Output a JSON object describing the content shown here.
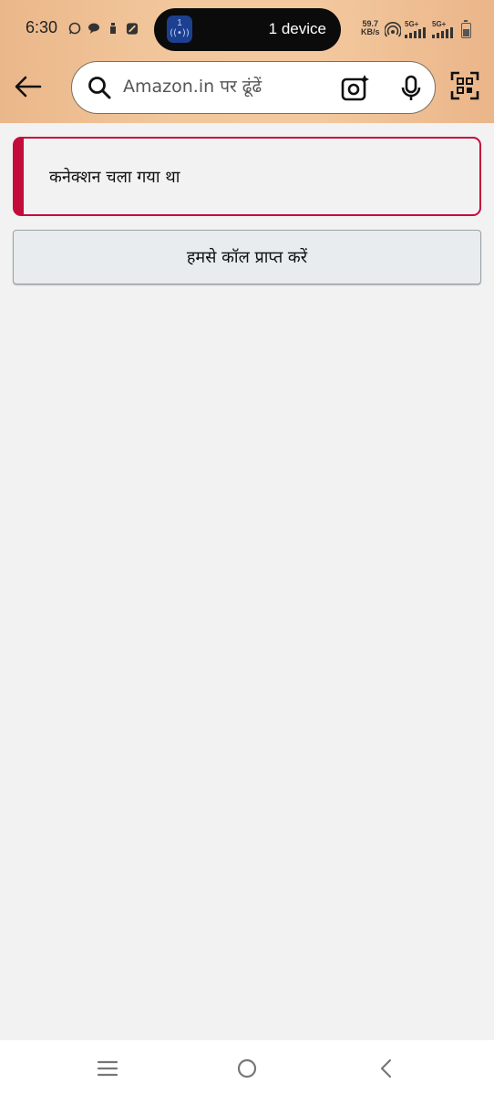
{
  "status_bar": {
    "time": "6:30",
    "pill_badge_number": "1",
    "pill_text": "1 device",
    "speed_value": "59.7",
    "speed_unit": "KB/s",
    "sim1_label": "5G+",
    "sim2_label": "5G+",
    "icons": [
      "whatsapp-icon",
      "chat-bubble-icon",
      "bottle-icon",
      "app-icon",
      "hotspot-icon",
      "signal-icon",
      "battery-icon"
    ]
  },
  "header": {
    "search_placeholder": "Amazon.in पर ढूंढें",
    "icons": [
      "back-arrow-icon",
      "search-icon",
      "camera-sparkle-icon",
      "microphone-icon",
      "qr-scan-icon"
    ]
  },
  "alert": {
    "message": "कनेक्शन चला गया था",
    "border_color": "#c40c3b"
  },
  "call_button": {
    "label": "हमसे कॉल प्राप्त करें"
  },
  "nav_bar": {
    "icons": [
      "menu-icon",
      "home-icon",
      "back-icon"
    ]
  },
  "colors": {
    "header_gradient": "#f2c79c",
    "background": "#f2f2f2",
    "button_bg": "#e8ecee"
  }
}
